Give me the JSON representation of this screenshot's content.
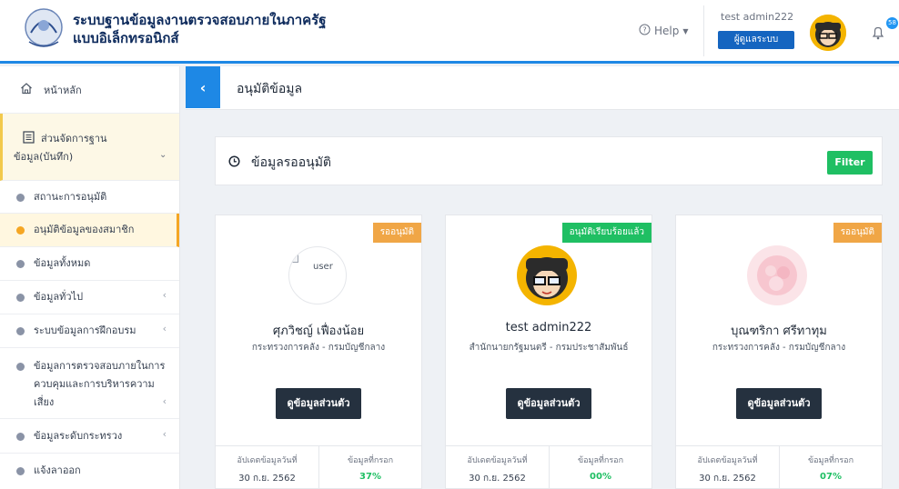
{
  "header": {
    "title_line1": "ระบบฐานข้อมูลงานตรวจสอบภายในภาครัฐ",
    "title_line2": "แบบอิเล็กทรอนิกส์",
    "help_label": "Help",
    "user_name": "test admin222",
    "role_label": "ผู้ดูแลระบบ",
    "notification_count": "58",
    "accent_color": "#1e88e5"
  },
  "sidebar": {
    "home_label": "หน้าหลัก",
    "group_label": "ส่วนจัดการฐานข้อมูล(บันทึก)",
    "items": [
      {
        "label": "สถานะการอนุมัติ"
      },
      {
        "label": "อนุมัติข้อมูลของสมาชิก"
      },
      {
        "label": "ข้อมูลทั้งหมด"
      },
      {
        "label": "ข้อมูลทั่วไป"
      },
      {
        "label": "ระบบข้อมูลการฝึกอบรม"
      },
      {
        "label": "ข้อมูลการตรวจสอบภายในการควบคุมและการบริหารความเสี่ยง"
      },
      {
        "label": "ข้อมูลระดับกระทรวง"
      },
      {
        "label": "แจ้งลาออก"
      }
    ]
  },
  "main": {
    "page_title": "อนุมัติข้อมูล",
    "panel_title": "ข้อมูลรออนุมัติ",
    "filter_label": "Filter",
    "cards": [
      {
        "status": "รออนุมัติ",
        "avatar_alt": "user",
        "name": "ศุภวิชญ์ เฟื่องน้อย",
        "org": "กระทรวงการคลัง - กรมบัญชีกลาง",
        "button": "ดูข้อมูลส่วนตัว",
        "updated_label": "อัปเดตข้อมูลวันที่",
        "updated_value": "30 ก.ย. 2562",
        "filled_label": "ข้อมูลที่กรอก",
        "filled_value": "37%"
      },
      {
        "status": "อนุมัติเรียบร้อยแล้ว",
        "avatar_alt": "",
        "name": "test admin222",
        "org": "สำนักนายกรัฐมนตรี - กรมประชาสัมพันธ์",
        "button": "ดูข้อมูลส่วนตัว",
        "updated_label": "อัปเดตข้อมูลวันที่",
        "updated_value": "30 ก.ย. 2562",
        "filled_label": "ข้อมูลที่กรอก",
        "filled_value": "00%"
      },
      {
        "status": "รออนุมัติ",
        "avatar_alt": "",
        "name": "บุณฑริกา ศรีทาทุม",
        "org": "กระทรวงการคลัง - กรมบัญชีกลาง",
        "button": "ดูข้อมูลส่วนตัว",
        "updated_label": "อัปเดตข้อมูลวันที่",
        "updated_value": "30 ก.ย. 2562",
        "filled_label": "ข้อมูลที่กรอก",
        "filled_value": "07%"
      }
    ]
  }
}
